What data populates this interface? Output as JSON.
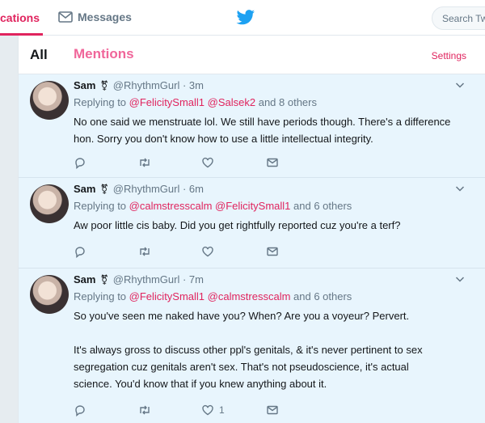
{
  "nav": {
    "notifications_label": "cations",
    "messages_label": "Messages",
    "search_placeholder": "Search Tw"
  },
  "tabs": {
    "all_label": "All",
    "mentions_label": "Mentions",
    "settings_label": "Settings"
  },
  "colors": {
    "accent": "#e0245e",
    "mentions_tab": "#f0669a",
    "tweet_bg": "#e8f5fd",
    "twitter_blue": "#1da1f2"
  },
  "tweets": [
    {
      "name": "Sam",
      "handle": "@RhythmGurl",
      "time": "· 3m",
      "reply_prefix": "Replying to ",
      "reply_mentions": "@FelicitySmall1 @Salsek2",
      "reply_suffix": " and 8 others",
      "text_lines": [
        "No one said we menstruate lol. We still have periods though. There's a difference",
        "hon. Sorry you don't know how to use a little intellectual integrity."
      ],
      "like_count": ""
    },
    {
      "name": "Sam",
      "handle": "@RhythmGurl",
      "time": "· 6m",
      "reply_prefix": "Replying to ",
      "reply_mentions": "@calmstresscalm @FelicitySmall1",
      "reply_suffix": " and 6 others",
      "text_lines": [
        "Aw poor little cis baby. Did you get rightfully reported cuz you're a terf?"
      ],
      "like_count": ""
    },
    {
      "name": "Sam",
      "handle": "@RhythmGurl",
      "time": "· 7m",
      "reply_prefix": "Replying to ",
      "reply_mentions": "@FelicitySmall1 @calmstresscalm",
      "reply_suffix": " and 6 others",
      "text_lines": [
        "So you've seen me naked have you? When? Are you a voyeur? Pervert.",
        "",
        "It's always gross to discuss other ppl's genitals, & it's never pertinent to sex",
        "segregation cuz genitals aren't sex. That's not pseudoscience, it's actual",
        "science. You'd know that if you knew anything about it."
      ],
      "like_count": "1"
    }
  ]
}
